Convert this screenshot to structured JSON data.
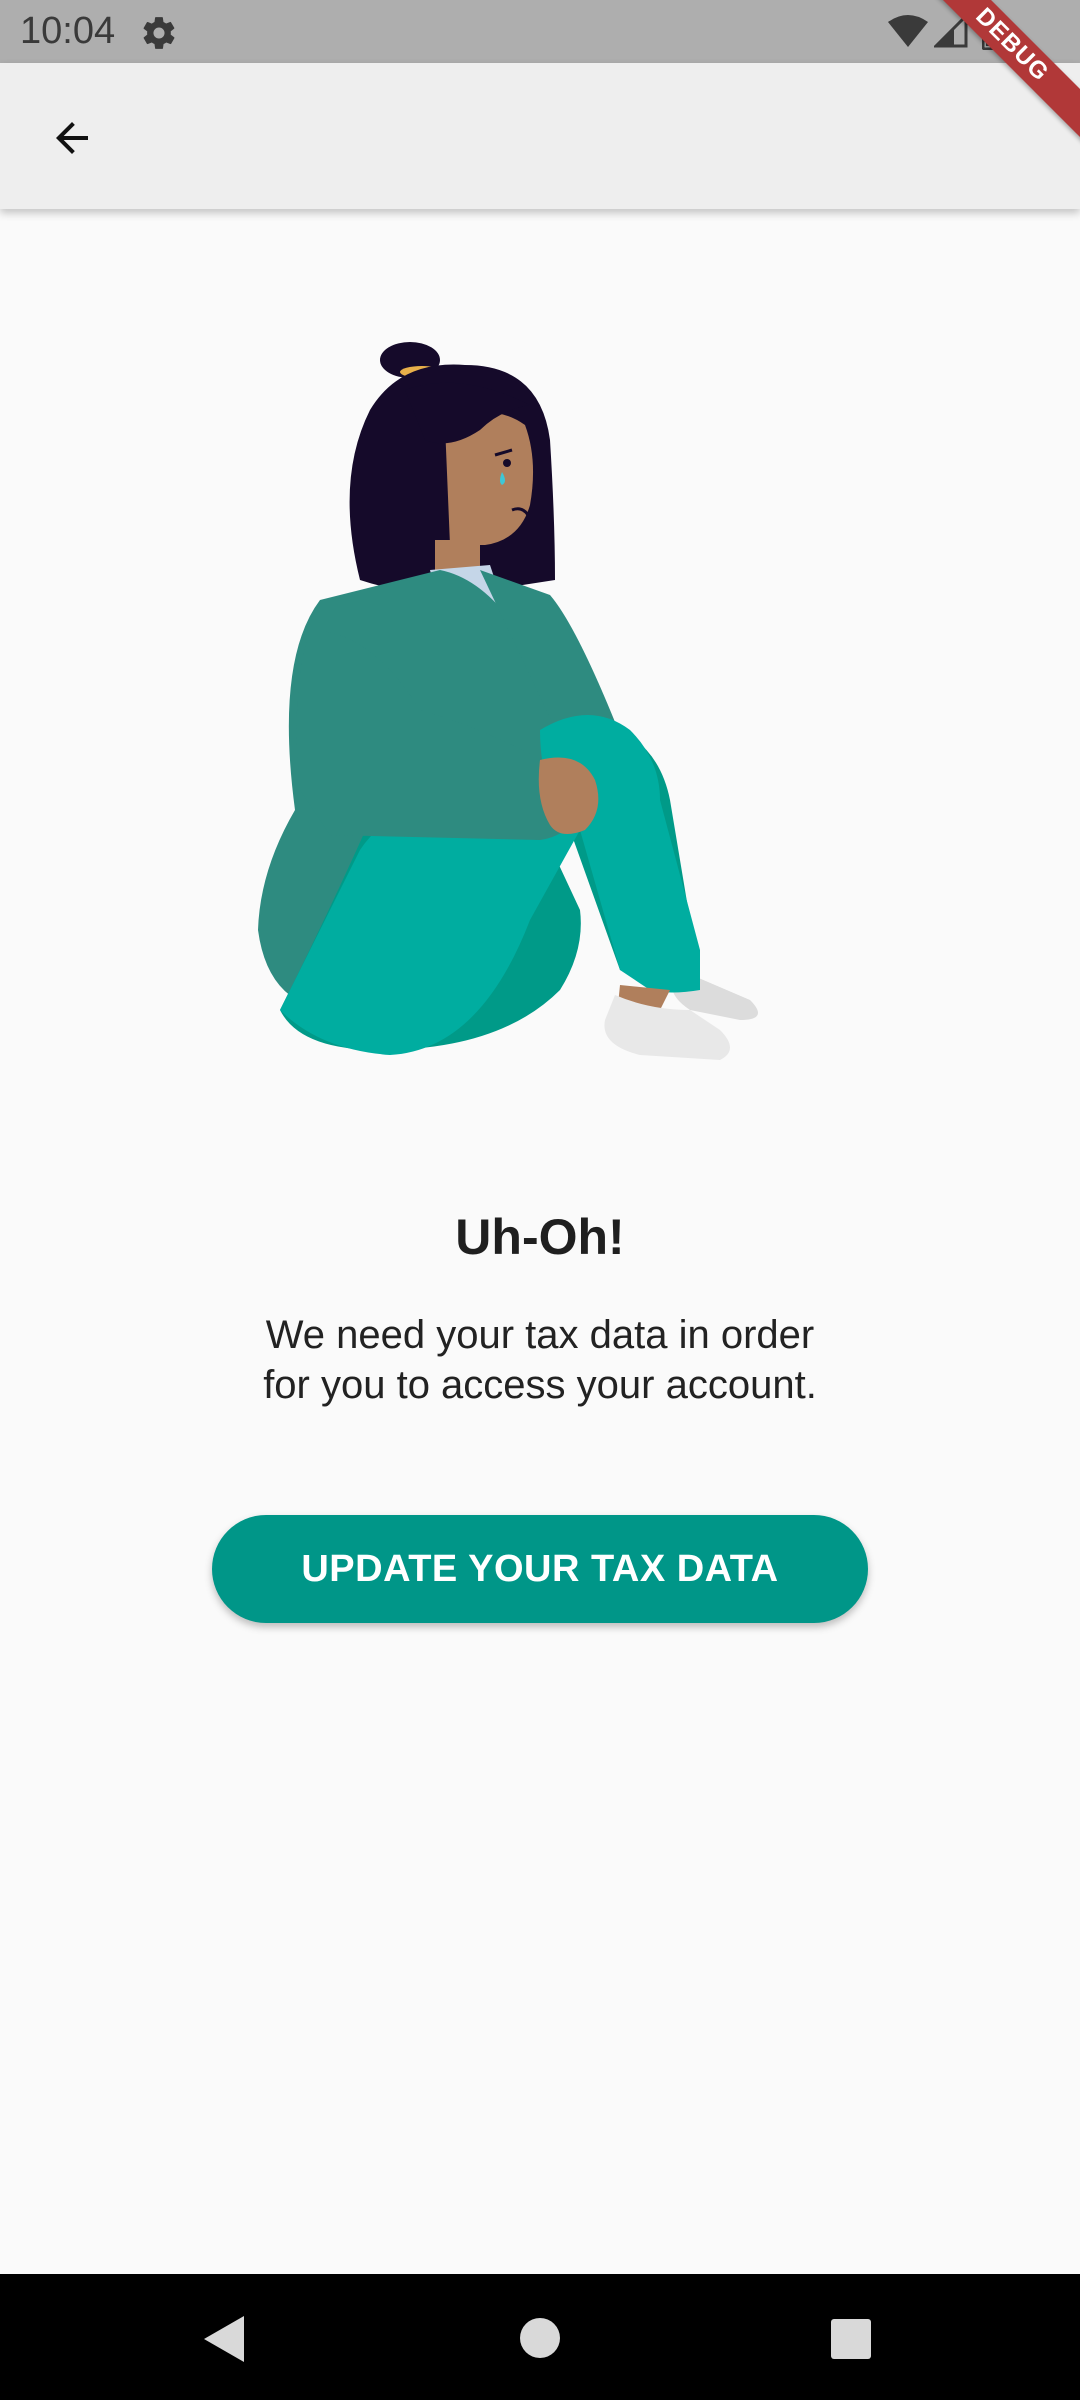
{
  "status_bar": {
    "time": "10:04",
    "icons": [
      "gear-icon",
      "wifi-icon",
      "signal-icon",
      "battery-icon"
    ]
  },
  "debug_banner": {
    "label": "DEBUG",
    "color": "#b13838"
  },
  "app_bar": {
    "back_icon": "arrow-back-icon"
  },
  "illustration": {
    "subject": "sad-person-sitting-illustration"
  },
  "content": {
    "title": "Uh-Oh!",
    "message": "We need your tax data in order for you to access your account.",
    "button_label": "UPDATE YOUR TAX DATA"
  },
  "colors": {
    "accent": "#009688",
    "background": "#fafafa",
    "app_bar": "#eeeeee",
    "status_bar": "#aeaeae"
  },
  "nav_bar": {
    "icons": [
      "nav-back-icon",
      "nav-home-icon",
      "nav-recents-icon"
    ]
  }
}
